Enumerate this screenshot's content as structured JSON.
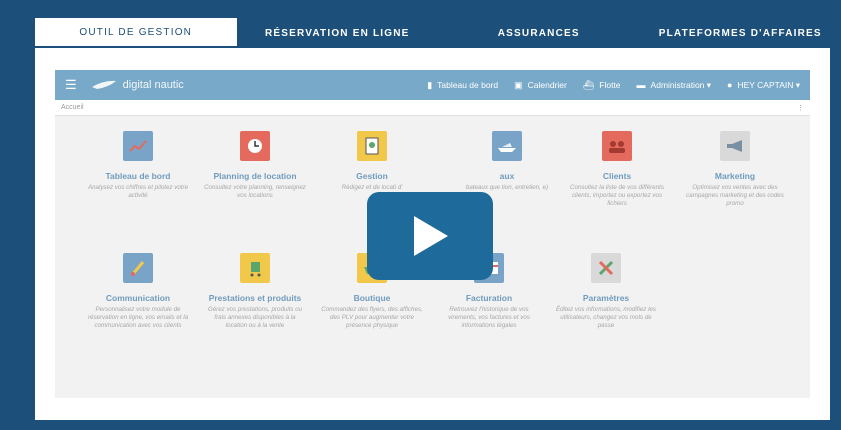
{
  "tabs": [
    "OUTIL DE GESTION",
    "RÉSERVATION EN LIGNE",
    "ASSURANCES",
    "PLATEFORMES D'AFFAIRES"
  ],
  "app": {
    "logo": "digital nautic",
    "nav": {
      "dashboard": "Tableau de bord",
      "calendar": "Calendrier",
      "fleet": "Flotte",
      "admin": "Administration ▾",
      "user": "HEY CAPTAIN ▾"
    },
    "breadcrumb": "Accueil",
    "menu": "⋮"
  },
  "modules": [
    {
      "title": "Tableau de bord",
      "desc": "Analysez vos chiffres et pilotez votre activité",
      "color": "#7aa4c7"
    },
    {
      "title": "Planning de location",
      "desc": "Consultez votre planning, renseignez vos locations",
      "color": "#e36a5c"
    },
    {
      "title": "Gestion",
      "desc": "Rédigez et de locati d'",
      "color": "#f2c84b"
    },
    {
      "title": "aux",
      "desc": "bateaux que tion, entretien, e)",
      "color": "#7aa4c7"
    },
    {
      "title": "Clients",
      "desc": "Consultez la liste de vos différents clients, importez ou exportez vos fichiers",
      "color": "#e36a5c"
    },
    {
      "title": "Marketing",
      "desc": "Optimisez vos ventes avec des campagnes marketing et des codes promo",
      "color": "#d9d9d9"
    },
    {
      "title": "Communication",
      "desc": "Personnalisez votre module de réservation en ligne, vos emails et la communication avec vos clients",
      "color": "#7aa4c7"
    },
    {
      "title": "Prestations et produits",
      "desc": "Gérez vos prestations, produits ou frais annexes disponibles à la location ou à la vente",
      "color": "#f2c84b"
    },
    {
      "title": "Boutique",
      "desc": "Commandez des flyers, des affiches, des PLV pour augmenter votre présence physique",
      "color": "#f2c84b"
    },
    {
      "title": "Facturation",
      "desc": "Retrouvez l'historique de vos virements, vos factures et vos informations légales",
      "color": "#7aa4c7"
    },
    {
      "title": "Paramètres",
      "desc": "Éditez vos informations, modifiez les utilisateurs, changez vos mots de passe",
      "color": "#d9d9d9"
    }
  ]
}
